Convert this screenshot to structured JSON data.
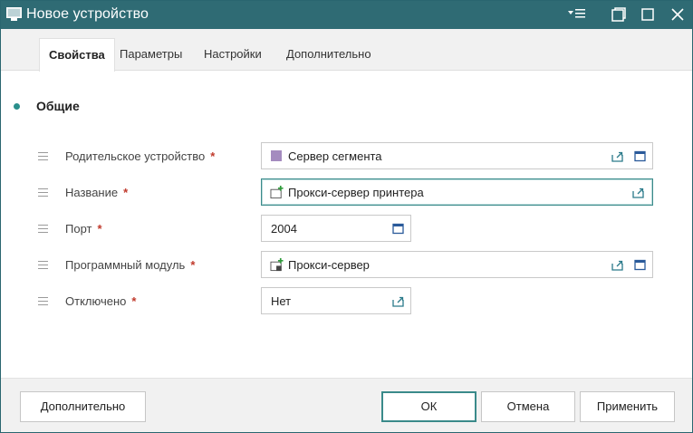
{
  "window": {
    "title": "Новое устройство"
  },
  "tabs": [
    {
      "label": "Свойства",
      "active": true
    },
    {
      "label": "Параметры",
      "active": false
    },
    {
      "label": "Настройки",
      "active": false
    },
    {
      "label": "Дополнительно",
      "active": false
    }
  ],
  "section": {
    "title": "Общие"
  },
  "fields": [
    {
      "label": "Родительское устройство",
      "required": "*",
      "value": "Сервер сегмента",
      "icon": "segment-server-icon",
      "icon_color": "#a48bbf"
    },
    {
      "label": "Название",
      "required": "*",
      "value": "Прокси-сервер принтера",
      "icon": "new-device-icon"
    },
    {
      "label": "Порт",
      "required": "*",
      "value": "2004"
    },
    {
      "label": "Программный модуль",
      "required": "*",
      "value": "Прокси-сервер",
      "icon": "module-icon"
    },
    {
      "label": "Отключено",
      "required": "*",
      "value": "Нет"
    }
  ],
  "footer": {
    "more_label": "Дополнительно",
    "ok_label": "ОК",
    "cancel_label": "Отмена",
    "apply_label": "Применить"
  },
  "colors": {
    "titlebar": "#2f6b74",
    "accent": "#3a8a8a",
    "required": "#c0392b"
  }
}
